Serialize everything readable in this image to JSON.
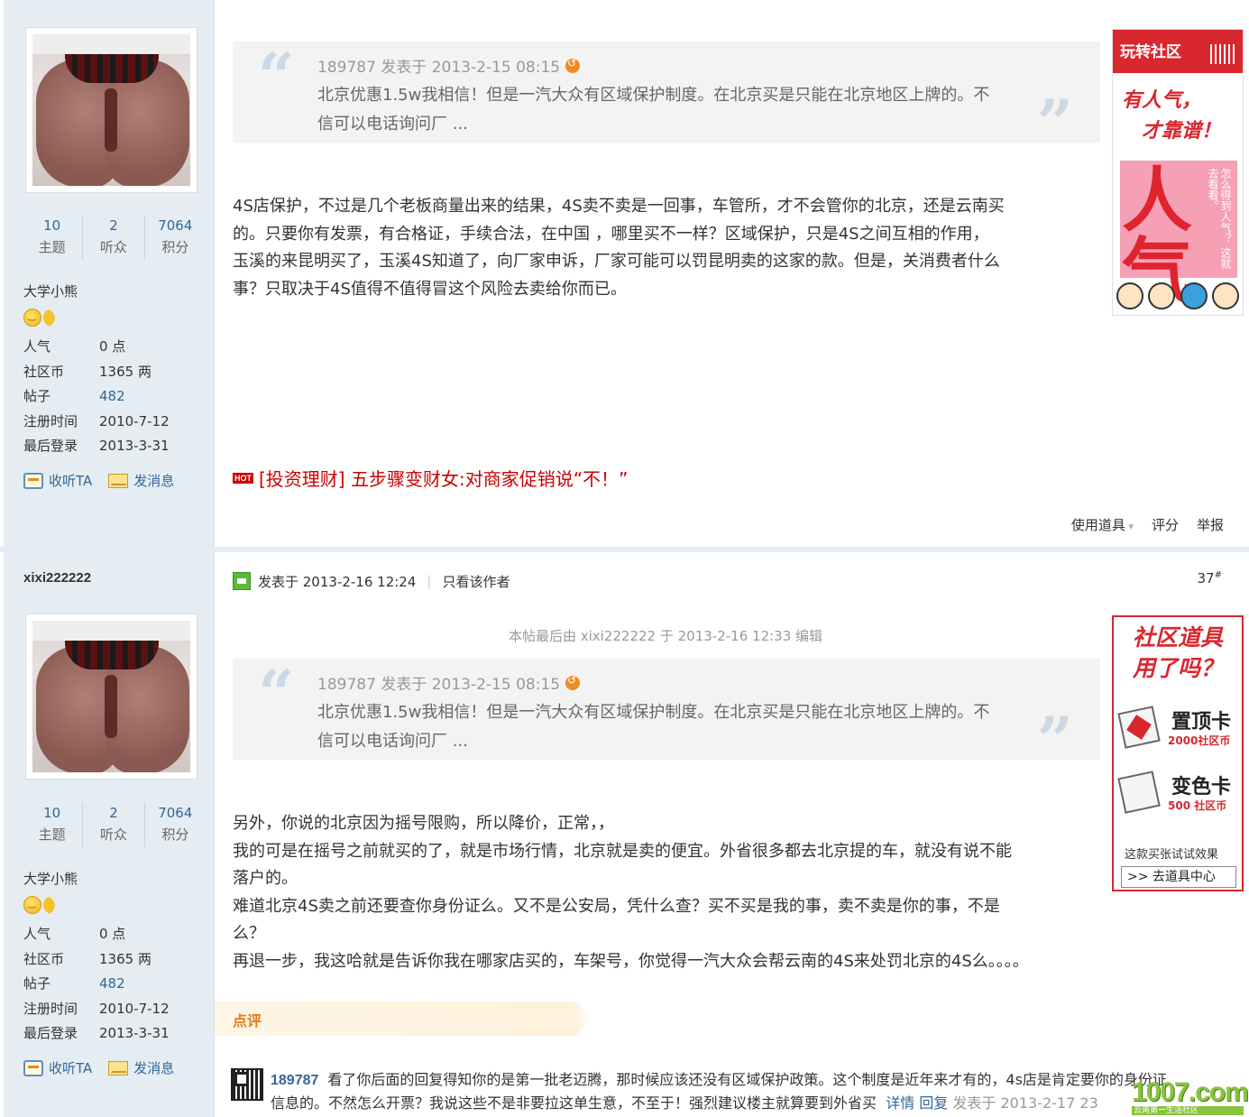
{
  "post1": {
    "author": {
      "stats": [
        {
          "num": "10",
          "label": "主题"
        },
        {
          "num": "2",
          "label": "听众"
        },
        {
          "num": "7064",
          "label": "积分"
        }
      ],
      "title": "大学小熊",
      "info": [
        {
          "k": "人气",
          "v": "0 点"
        },
        {
          "k": "社区币",
          "v": "1365 两"
        },
        {
          "k": "帖子",
          "v": "482"
        },
        {
          "k": "注册时间",
          "v": "2010-7-12"
        },
        {
          "k": "最后登录",
          "v": "2013-3-31"
        }
      ],
      "follow": "收听TA",
      "message": "发消息"
    },
    "quote": {
      "head": "189787 发表于 2013-2-15 08:15",
      "body": "北京优惠1.5w我相信！但是一汽大众有区域保护制度。在北京买是只能在北京地区上牌的。不信可以电话询问厂 ..."
    },
    "body_lines": [
      "4S店保护，不过是几个老板商量出来的结果，4S卖不卖是一回事，车管所，才不会管你的北京，还是云南买",
      "的。只要你有发票，有合格证，手续合法，在中国 ，哪里买不一样？区域保护，只是4S之间互相的作用，",
      "玉溪的来昆明买了，玉溪4S知道了，向厂家申诉，厂家可能可以罚昆明卖的这家的款。但是，关消费者什么",
      "事？只取决于4S值得不值得冒这个风险去卖给你而已。"
    ],
    "hot_badge": "HOT",
    "hot_link": "[投资理财] 五步骤变财女:对商家促销说“不！”",
    "tools": [
      "使用道具",
      "评分",
      "举报"
    ],
    "ad": {
      "top": "玩转社区",
      "line1": "有人气，",
      "line2": "才靠谱！",
      "big": "人气",
      "vertical": "怎么得到人气？ 这就去看看。"
    }
  },
  "post2": {
    "author": {
      "name": "xixi222222",
      "stats": [
        {
          "num": "10",
          "label": "主题"
        },
        {
          "num": "2",
          "label": "听众"
        },
        {
          "num": "7064",
          "label": "积分"
        }
      ],
      "title": "大学小熊",
      "info": [
        {
          "k": "人气",
          "v": "0 点"
        },
        {
          "k": "社区币",
          "v": "1365 两"
        },
        {
          "k": "帖子",
          "v": "482"
        },
        {
          "k": "注册时间",
          "v": "2010-7-12"
        },
        {
          "k": "最后登录",
          "v": "2013-3-31"
        }
      ],
      "follow": "收听TA",
      "message": "发消息"
    },
    "posted": "发表于 2013-2-16 12:24",
    "only_author": "只看该作者",
    "floor": "37",
    "floor_sup": "#",
    "edited": "本帖最后由 xixi222222 于 2013-2-16 12:33 编辑",
    "quote": {
      "head": "189787 发表于 2013-2-15 08:15",
      "body": "北京优惠1.5w我相信！但是一汽大众有区域保护制度。在北京买是只能在北京地区上牌的。不信可以电话询问厂 ..."
    },
    "body_lines": [
      "另外，你说的北京因为摇号限购，所以降价，正常，，",
      "我的可是在摇号之前就买的了，就是市场行情，北京就是卖的便宜。外省很多都去北京提的车，就没有说不能",
      "落户的。",
      "难道北京4S卖之前还要查你身份证么。又不是公安局，凭什么查？买不买是我的事，卖不卖是你的事，不是",
      "么？",
      "再退一步，我这哈就是告诉你我在哪家店买的，车架号，你觉得一汽大众会帮云南的4S来处罚北京的4S么。。。。"
    ],
    "comment_title": "点评",
    "comment": {
      "user": "189787",
      "line1": "看了你后面的回复得知你的是第一批老迈腾，那时候应该还没有区域保护政策。这个制度是近年来才有的，4s店是肯定要你的身份证",
      "line2": "信息的。不然怎么开票？我说这些不是非要拉这单生意，不至于！强烈建议楼主就算要到外省买",
      "detail": "详情",
      "reply": "回复",
      "time": "发表于 2013-2-17 23"
    },
    "ad": {
      "title1": "社区道具",
      "title2": "用了吗？",
      "item1_name": "置顶卡",
      "item1_price": "2000社区币",
      "item2_name": "变色卡",
      "item2_price": "500 社区币",
      "note": "这款买张试试效果",
      "button": ">> 去道具中心"
    }
  },
  "watermark": {
    "logo": "1007.com",
    "slogan": "云南第一生活社区"
  },
  "colors": {
    "link": "#336699",
    "sidebar": "#e5edf2",
    "hot": "#cc0000",
    "comment": "#e07a1f"
  }
}
